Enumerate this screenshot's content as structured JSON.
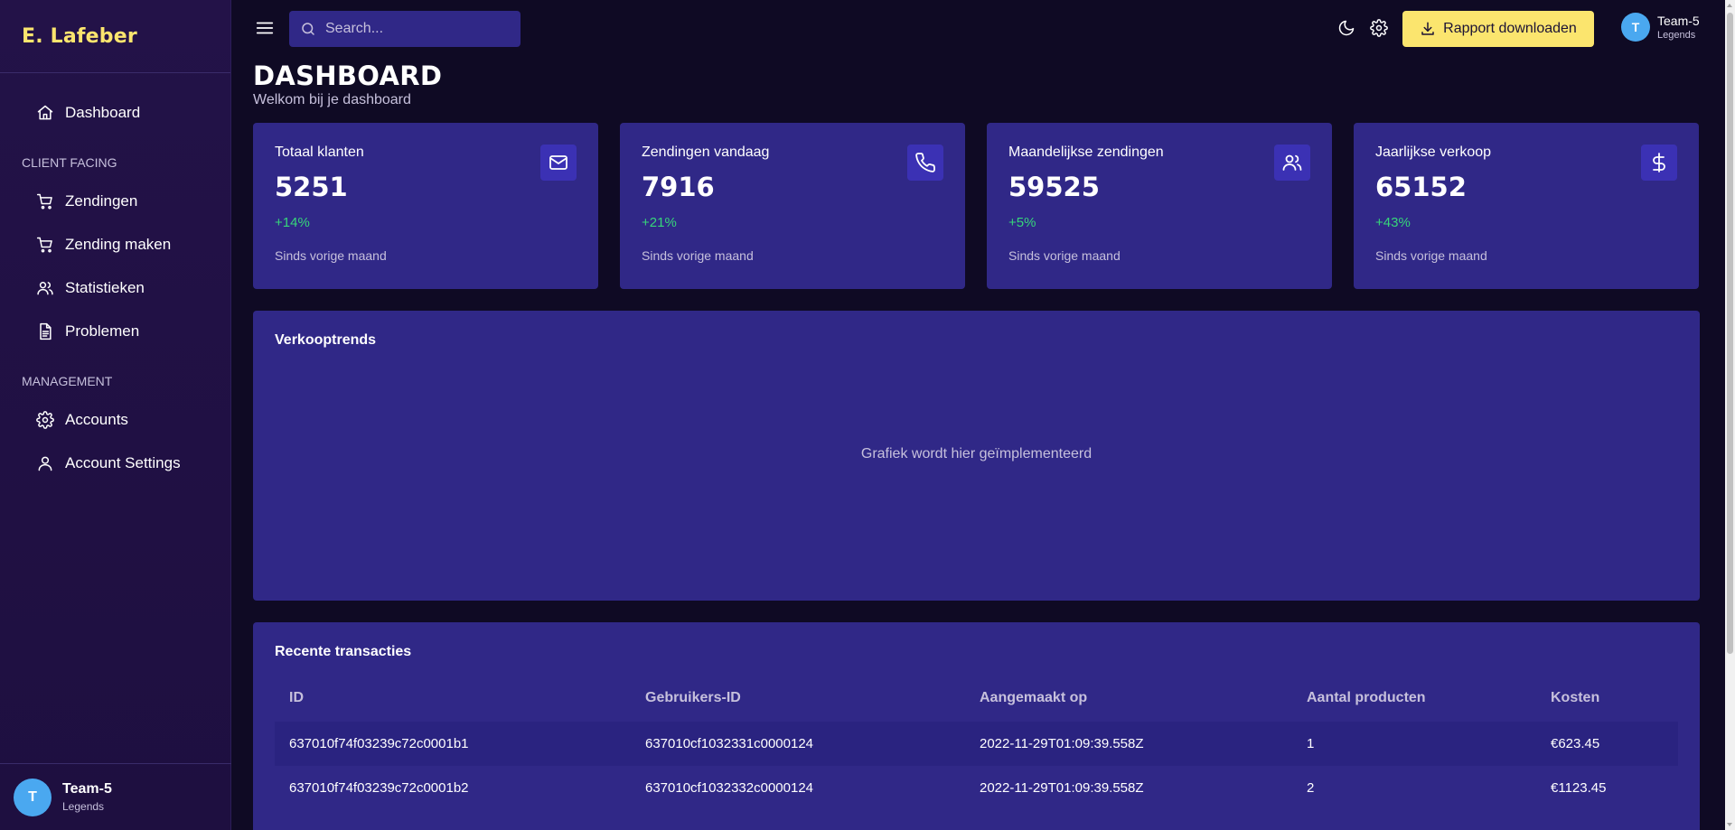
{
  "brand": "E. Lafeber",
  "sidebar": {
    "items_top": [
      {
        "label": "Dashboard",
        "icon": "home-icon"
      }
    ],
    "section_client": "CLIENT FACING",
    "items_client": [
      {
        "label": "Zendingen",
        "icon": "cart-icon"
      },
      {
        "label": "Zending maken",
        "icon": "cart-icon"
      },
      {
        "label": "Statistieken",
        "icon": "users-icon"
      },
      {
        "label": "Problemen",
        "icon": "document-icon"
      }
    ],
    "section_management": "MANAGEMENT",
    "items_management": [
      {
        "label": "Accounts",
        "icon": "gear-icon"
      },
      {
        "label": "Account Settings",
        "icon": "user-icon"
      }
    ],
    "user": {
      "initial": "T",
      "name": "Team-5",
      "role": "Legends"
    }
  },
  "topbar": {
    "search_placeholder": "Search...",
    "download_label": "Rapport downloaden",
    "user": {
      "initial": "T",
      "name": "Team-5",
      "role": "Legends"
    }
  },
  "page": {
    "title": "DASHBOARD",
    "subtitle": "Welkom bij je dashboard"
  },
  "stats": [
    {
      "title": "Totaal klanten",
      "value": "5251",
      "change": "+14%",
      "foot": "Sinds vorige maand",
      "icon": "mail-icon"
    },
    {
      "title": "Zendingen vandaag",
      "value": "7916",
      "change": "+21%",
      "foot": "Sinds vorige maand",
      "icon": "phone-icon"
    },
    {
      "title": "Maandelijkse zendingen",
      "value": "59525",
      "change": "+5%",
      "foot": "Sinds vorige maand",
      "icon": "users-icon"
    },
    {
      "title": "Jaarlijkse verkoop",
      "value": "65152",
      "change": "+43%",
      "foot": "Sinds vorige maand",
      "icon": "dollar-icon"
    }
  ],
  "chart_panel": {
    "title": "Verkooptrends",
    "placeholder": "Grafiek wordt hier geïmplementeerd"
  },
  "transactions": {
    "title": "Recente transacties",
    "headers": [
      "ID",
      "Gebruikers-ID",
      "Aangemaakt op",
      "Aantal producten",
      "Kosten"
    ],
    "rows": [
      [
        "637010f74f03239c72c0001b1",
        "637010cf1032331c0000124",
        "2022-11-29T01:09:39.558Z",
        "1",
        "€623.45"
      ],
      [
        "637010f74f03239c72c0001b2",
        "637010cf1032332c0000124",
        "2022-11-29T01:09:39.558Z",
        "2",
        "€1123.45"
      ]
    ]
  },
  "colors": {
    "background": "#0f0a24",
    "sidebar": "#231248",
    "card": "#302887",
    "accent": "#fbe56e",
    "positive": "#37d67a",
    "avatar": "#4aa8f0"
  }
}
